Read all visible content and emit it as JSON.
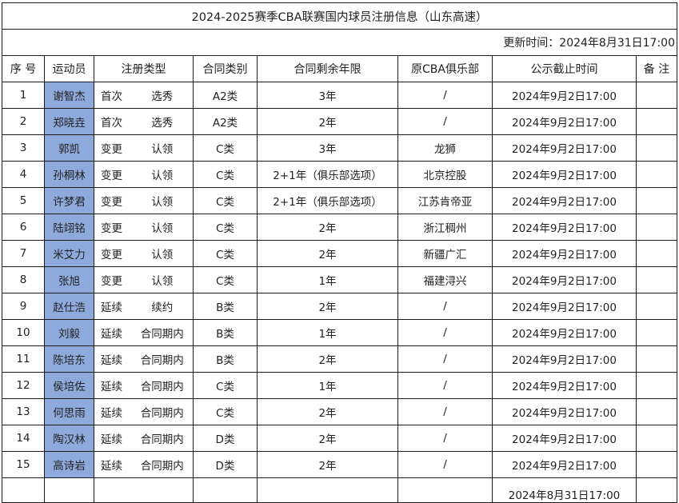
{
  "title": "2024-2025赛季CBA联赛国内球员注册信息（山东高速）",
  "update_time": "更新时间：2024年8月31日17:00",
  "headers": {
    "index": "序 号",
    "player": "运动员",
    "reg_type": "注册类型",
    "contract_type": "合同类别",
    "years_left": "合同剩余年限",
    "former_club": "原CBA俱乐部",
    "deadline": "公示截止时间",
    "notes": "备 注"
  },
  "rows": [
    {
      "no": "1",
      "name": "谢智杰",
      "reg1": "首次",
      "reg2": "选秀",
      "ctype": "A2类",
      "years": "3年",
      "club": "/",
      "deadline": "2024年9月2日17:00",
      "note": ""
    },
    {
      "no": "2",
      "name": "郑晓垚",
      "reg1": "首次",
      "reg2": "选秀",
      "ctype": "A2类",
      "years": "2年",
      "club": "/",
      "deadline": "2024年9月2日17:00",
      "note": ""
    },
    {
      "no": "3",
      "name": "郭凯",
      "reg1": "变更",
      "reg2": "认领",
      "ctype": "C类",
      "years": "3年",
      "club": "龙狮",
      "deadline": "2024年9月2日17:00",
      "note": ""
    },
    {
      "no": "4",
      "name": "孙桐林",
      "reg1": "变更",
      "reg2": "认领",
      "ctype": "C类",
      "years": "2+1年（俱乐部选项）",
      "club": "北京控股",
      "deadline": "2024年9月2日17:00",
      "note": ""
    },
    {
      "no": "5",
      "name": "许梦君",
      "reg1": "变更",
      "reg2": "认领",
      "ctype": "C类",
      "years": "2+1年（俱乐部选项）",
      "club": "江苏肯帝亚",
      "deadline": "2024年9月2日17:00",
      "note": ""
    },
    {
      "no": "6",
      "name": "陆翊铭",
      "reg1": "变更",
      "reg2": "认领",
      "ctype": "C类",
      "years": "2年",
      "club": "浙江稠州",
      "deadline": "2024年9月2日17:00",
      "note": ""
    },
    {
      "no": "7",
      "name": "米艾力",
      "reg1": "变更",
      "reg2": "认领",
      "ctype": "C类",
      "years": "2年",
      "club": "新疆广汇",
      "deadline": "2024年9月2日17:00",
      "note": ""
    },
    {
      "no": "8",
      "name": "张旭",
      "reg1": "变更",
      "reg2": "认领",
      "ctype": "C类",
      "years": "1年",
      "club": "福建浔兴",
      "deadline": "2024年9月2日17:00",
      "note": ""
    },
    {
      "no": "9",
      "name": "赵仕浩",
      "reg1": "延续",
      "reg2": "续约",
      "ctype": "B类",
      "years": "2年",
      "club": "/",
      "deadline": "2024年9月2日17:00",
      "note": ""
    },
    {
      "no": "10",
      "name": "刘毅",
      "reg1": "延续",
      "reg2": "合同期内",
      "ctype": "B类",
      "years": "1年",
      "club": "/",
      "deadline": "2024年9月2日17:00",
      "note": ""
    },
    {
      "no": "11",
      "name": "陈培东",
      "reg1": "延续",
      "reg2": "合同期内",
      "ctype": "B类",
      "years": "2年",
      "club": "/",
      "deadline": "2024年9月2日17:00",
      "note": ""
    },
    {
      "no": "12",
      "name": "侯培佐",
      "reg1": "延续",
      "reg2": "合同期内",
      "ctype": "C类",
      "years": "1年",
      "club": "/",
      "deadline": "2024年9月2日17:00",
      "note": ""
    },
    {
      "no": "13",
      "name": "何思雨",
      "reg1": "延续",
      "reg2": "合同期内",
      "ctype": "C类",
      "years": "2年",
      "club": "/",
      "deadline": "2024年9月2日17:00",
      "note": ""
    },
    {
      "no": "14",
      "name": "陶汉林",
      "reg1": "延续",
      "reg2": "合同期内",
      "ctype": "D类",
      "years": "2年",
      "club": "/",
      "deadline": "2024年9月2日17:00",
      "note": ""
    },
    {
      "no": "15",
      "name": "高诗岩",
      "reg1": "延续",
      "reg2": "合同期内",
      "ctype": "D类",
      "years": "2年",
      "club": "/",
      "deadline": "2024年9月2日17:00",
      "note": ""
    }
  ],
  "partial_row": {
    "deadline": "2024年8月31日17:00"
  },
  "colors": {
    "name_highlight": "#8eaadc",
    "border": "#1a1a1a",
    "text": "#222222"
  }
}
